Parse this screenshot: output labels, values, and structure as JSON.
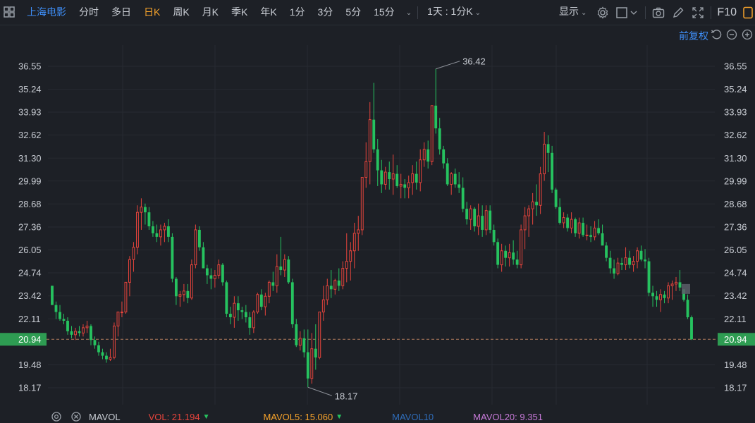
{
  "toolbar": {
    "stock_name": "上海电影",
    "periods": [
      "分时",
      "多日",
      "日K",
      "周K",
      "月K",
      "季K",
      "年K",
      "1分",
      "3分",
      "5分",
      "15分"
    ],
    "active_period": "日K",
    "interval_select": "1天 : 1分K",
    "display_label": "显示",
    "f10_label": "F10"
  },
  "subbar": {
    "adjust_label": "前复权"
  },
  "colors": {
    "up": "#e6443c",
    "down": "#26c25f",
    "accent": "#3e8ef7",
    "active": "#f7a32b",
    "last_price": "#2e9c52"
  },
  "volume_legend": {
    "title": "MAVOL",
    "vol": "VOL: 21.194",
    "mavol5": "MAVOL5: 15.060",
    "mavol10": "MAVOL10",
    "mavol20": "MAVOL20: 9.351"
  },
  "chart_data": {
    "type": "candlestick",
    "y_ticks": [
      "36.55",
      "35.24",
      "33.93",
      "32.62",
      "31.30",
      "29.99",
      "28.68",
      "27.36",
      "26.05",
      "24.74",
      "23.42",
      "22.11",
      "20.94",
      "19.48",
      "18.17"
    ],
    "ylim": [
      17.5,
      37.2
    ],
    "high_label": "36.42",
    "low_label": "18.17",
    "last_price": "20.94",
    "candles": [
      [
        24.0,
        24.0,
        22.9,
        22.9
      ],
      [
        22.9,
        23.1,
        22.1,
        22.5
      ],
      [
        22.5,
        22.9,
        22.0,
        22.1
      ],
      [
        22.1,
        22.4,
        21.8,
        22.0
      ],
      [
        22.0,
        22.2,
        21.2,
        21.4
      ],
      [
        21.4,
        21.7,
        21.0,
        21.2
      ],
      [
        21.2,
        21.6,
        20.9,
        21.4
      ],
      [
        21.4,
        21.7,
        21.1,
        21.3
      ],
      [
        21.3,
        21.8,
        21.1,
        21.6
      ],
      [
        21.6,
        22.0,
        21.3,
        21.7
      ],
      [
        21.7,
        21.8,
        20.6,
        20.9
      ],
      [
        20.9,
        21.1,
        20.4,
        20.6
      ],
      [
        20.6,
        20.8,
        20.0,
        20.2
      ],
      [
        20.2,
        20.4,
        19.8,
        20.0
      ],
      [
        20.0,
        20.2,
        19.6,
        19.8
      ],
      [
        19.8,
        20.4,
        19.7,
        19.9
      ],
      [
        19.9,
        21.9,
        19.8,
        21.7
      ],
      [
        21.7,
        22.5,
        21.1,
        22.5
      ],
      [
        22.5,
        23.1,
        22.2,
        22.5
      ],
      [
        22.5,
        24.2,
        22.4,
        24.2
      ],
      [
        24.2,
        25.7,
        23.4,
        25.5
      ],
      [
        25.5,
        26.5,
        24.8,
        26.2
      ],
      [
        26.2,
        28.6,
        25.8,
        28.2
      ],
      [
        28.2,
        29.0,
        27.2,
        28.5
      ],
      [
        28.5,
        28.7,
        27.5,
        28.2
      ],
      [
        28.2,
        28.5,
        27.2,
        27.4
      ],
      [
        27.4,
        27.7,
        26.8,
        27.0
      ],
      [
        27.0,
        27.5,
        26.5,
        26.8
      ],
      [
        26.8,
        27.5,
        26.3,
        27.2
      ],
      [
        27.2,
        27.6,
        26.5,
        27.4
      ],
      [
        27.4,
        27.8,
        26.5,
        26.8
      ],
      [
        26.8,
        27.0,
        24.2,
        24.4
      ],
      [
        24.4,
        24.5,
        22.9,
        23.4
      ],
      [
        23.4,
        23.7,
        22.8,
        23.5
      ],
      [
        23.5,
        24.1,
        23.1,
        23.7
      ],
      [
        23.7,
        24.1,
        23.0,
        23.3
      ],
      [
        23.3,
        25.5,
        23.2,
        25.2
      ],
      [
        25.2,
        27.5,
        25.0,
        27.2
      ],
      [
        27.2,
        27.4,
        26.0,
        26.2
      ],
      [
        26.2,
        26.5,
        25.0,
        25.0
      ],
      [
        25.0,
        25.2,
        24.1,
        24.6
      ],
      [
        24.6,
        25.0,
        23.8,
        24.4
      ],
      [
        24.4,
        24.9,
        23.9,
        24.6
      ],
      [
        24.6,
        25.5,
        24.4,
        25.2
      ],
      [
        25.2,
        25.3,
        24.0,
        24.2
      ],
      [
        24.2,
        24.3,
        22.2,
        22.4
      ],
      [
        22.4,
        22.8,
        21.8,
        22.2
      ],
      [
        22.2,
        23.4,
        21.6,
        23.0
      ],
      [
        23.0,
        23.4,
        22.0,
        22.6
      ],
      [
        22.6,
        22.8,
        22.1,
        22.5
      ],
      [
        22.5,
        22.9,
        21.9,
        22.2
      ],
      [
        22.2,
        22.5,
        21.2,
        21.6
      ],
      [
        21.6,
        22.6,
        21.3,
        22.5
      ],
      [
        22.5,
        23.6,
        22.4,
        23.5
      ],
      [
        23.5,
        23.8,
        22.6,
        22.8
      ],
      [
        22.8,
        23.6,
        22.3,
        23.4
      ],
      [
        23.4,
        24.3,
        23.0,
        24.2
      ],
      [
        24.2,
        24.8,
        23.7,
        24.0
      ],
      [
        24.0,
        25.8,
        23.6,
        25.1
      ],
      [
        25.1,
        26.8,
        24.6,
        24.9
      ],
      [
        24.9,
        25.8,
        24.5,
        25.5
      ],
      [
        25.5,
        25.7,
        24.1,
        24.2
      ],
      [
        24.2,
        24.4,
        21.6,
        21.8
      ],
      [
        21.8,
        22.1,
        20.5,
        20.6
      ],
      [
        20.6,
        21.4,
        20.3,
        21.0
      ],
      [
        21.0,
        21.5,
        19.9,
        20.2
      ],
      [
        20.2,
        21.5,
        18.2,
        18.7
      ],
      [
        18.7,
        21.3,
        18.4,
        20.4
      ],
      [
        20.4,
        21.8,
        19.2,
        19.9
      ],
      [
        19.9,
        22.5,
        19.8,
        22.5
      ],
      [
        22.5,
        24.0,
        22.0,
        23.2
      ],
      [
        23.2,
        24.4,
        22.9,
        24.0
      ],
      [
        24.0,
        24.9,
        23.3,
        23.8
      ],
      [
        23.8,
        24.4,
        23.5,
        24.3
      ],
      [
        24.3,
        25.0,
        23.7,
        24.0
      ],
      [
        24.0,
        25.4,
        23.8,
        25.0
      ],
      [
        25.0,
        27.0,
        24.2,
        25.4
      ],
      [
        25.4,
        26.5,
        24.3,
        26.0
      ],
      [
        26.0,
        27.6,
        25.0,
        27.0
      ],
      [
        27.0,
        28.0,
        26.0,
        27.2
      ],
      [
        27.2,
        30.2,
        26.9,
        30.2
      ],
      [
        30.2,
        32.2,
        29.6,
        31.1
      ],
      [
        31.1,
        34.5,
        29.8,
        33.5
      ],
      [
        33.5,
        35.6,
        31.6,
        31.8
      ],
      [
        31.8,
        32.4,
        29.7,
        30.6
      ],
      [
        30.6,
        31.2,
        29.3,
        29.8
      ],
      [
        29.8,
        30.8,
        29.5,
        30.5
      ],
      [
        30.5,
        31.1,
        29.5,
        30.1
      ],
      [
        30.1,
        31.5,
        29.2,
        30.4
      ],
      [
        30.4,
        30.9,
        29.6,
        29.7
      ],
      [
        29.7,
        30.4,
        29.0,
        29.8
      ],
      [
        29.8,
        30.1,
        29.0,
        29.6
      ],
      [
        29.6,
        30.3,
        29.0,
        29.9
      ],
      [
        29.9,
        30.9,
        29.2,
        30.4
      ],
      [
        30.4,
        31.1,
        29.5,
        29.9
      ],
      [
        29.9,
        31.8,
        29.4,
        31.2
      ],
      [
        31.2,
        32.2,
        30.8,
        31.8
      ],
      [
        31.8,
        32.3,
        30.7,
        31.1
      ],
      [
        31.1,
        33.5,
        30.9,
        34.3
      ],
      [
        34.3,
        36.4,
        32.7,
        33.0
      ],
      [
        33.0,
        33.6,
        31.5,
        31.8
      ],
      [
        31.8,
        32.0,
        30.7,
        31.0
      ],
      [
        31.0,
        31.3,
        29.7,
        29.8
      ],
      [
        29.8,
        30.5,
        29.2,
        30.4
      ],
      [
        30.4,
        30.7,
        29.6,
        29.8
      ],
      [
        29.8,
        30.5,
        29.3,
        29.6
      ],
      [
        29.6,
        30.2,
        28.2,
        28.4
      ],
      [
        28.4,
        28.8,
        27.5,
        27.8
      ],
      [
        27.8,
        28.6,
        27.2,
        28.4
      ],
      [
        28.4,
        28.5,
        27.1,
        27.4
      ],
      [
        27.4,
        28.7,
        26.9,
        28.0
      ],
      [
        28.0,
        28.6,
        26.8,
        27.2
      ],
      [
        27.2,
        28.6,
        26.9,
        28.3
      ],
      [
        28.3,
        28.6,
        27.0,
        27.2
      ],
      [
        27.2,
        27.5,
        26.3,
        26.5
      ],
      [
        26.5,
        26.7,
        25.0,
        25.2
      ],
      [
        25.2,
        26.4,
        24.8,
        26.0
      ],
      [
        26.0,
        26.3,
        25.1,
        25.6
      ],
      [
        25.6,
        26.4,
        25.1,
        25.9
      ],
      [
        25.9,
        26.6,
        25.2,
        25.5
      ],
      [
        25.5,
        26.0,
        25.0,
        25.2
      ],
      [
        25.2,
        27.5,
        25.0,
        27.2
      ],
      [
        27.2,
        28.5,
        26.1,
        28.0
      ],
      [
        28.0,
        28.6,
        26.8,
        28.4
      ],
      [
        28.4,
        29.3,
        27.5,
        28.8
      ],
      [
        28.8,
        29.8,
        28.0,
        28.6
      ],
      [
        28.6,
        30.8,
        28.1,
        30.4
      ],
      [
        30.4,
        32.8,
        30.0,
        32.1
      ],
      [
        32.1,
        32.6,
        30.5,
        31.6
      ],
      [
        31.6,
        32.0,
        29.3,
        29.5
      ],
      [
        29.5,
        29.6,
        28.4,
        28.5
      ],
      [
        28.5,
        29.0,
        27.5,
        27.6
      ],
      [
        27.6,
        28.2,
        27.3,
        27.9
      ],
      [
        27.9,
        28.1,
        27.1,
        27.3
      ],
      [
        27.3,
        28.2,
        27.0,
        27.8
      ],
      [
        27.8,
        27.9,
        26.8,
        27.0
      ],
      [
        27.0,
        27.9,
        26.7,
        27.6
      ],
      [
        27.6,
        27.9,
        26.8,
        26.9
      ],
      [
        26.9,
        27.5,
        26.6,
        26.9
      ],
      [
        26.9,
        27.4,
        26.5,
        26.8
      ],
      [
        26.8,
        27.7,
        26.6,
        27.3
      ],
      [
        27.3,
        27.8,
        26.9,
        27.0
      ],
      [
        27.0,
        27.5,
        26.6,
        26.3
      ],
      [
        26.3,
        26.5,
        25.4,
        25.6
      ],
      [
        25.6,
        26.0,
        24.7,
        25.0
      ],
      [
        25.0,
        25.5,
        24.4,
        24.7
      ],
      [
        24.7,
        25.6,
        24.6,
        25.3
      ],
      [
        25.3,
        25.6,
        24.9,
        25.2
      ],
      [
        25.2,
        26.2,
        24.9,
        25.6
      ],
      [
        25.6,
        26.0,
        25.0,
        25.2
      ],
      [
        25.2,
        25.7,
        24.8,
        25.4
      ],
      [
        25.4,
        26.2,
        25.0,
        26.0
      ],
      [
        26.0,
        26.3,
        25.4,
        25.5
      ],
      [
        25.5,
        26.1,
        25.0,
        25.4
      ],
      [
        25.4,
        25.6,
        23.4,
        23.6
      ],
      [
        23.6,
        24.0,
        22.8,
        23.4
      ],
      [
        23.4,
        23.7,
        22.8,
        23.2
      ],
      [
        23.2,
        23.8,
        22.5,
        23.5
      ],
      [
        23.5,
        23.7,
        23.0,
        23.3
      ],
      [
        23.3,
        24.2,
        23.0,
        24.0
      ],
      [
        24.0,
        24.3,
        23.2,
        24.1
      ],
      [
        24.1,
        24.5,
        23.7,
        24.2
      ],
      [
        24.2,
        24.9,
        23.7,
        23.9
      ],
      [
        23.8,
        23.8,
        23.1,
        23.2
      ],
      [
        23.2,
        23.5,
        22.1,
        22.2
      ],
      [
        22.2,
        22.3,
        20.9,
        20.94
      ]
    ]
  }
}
